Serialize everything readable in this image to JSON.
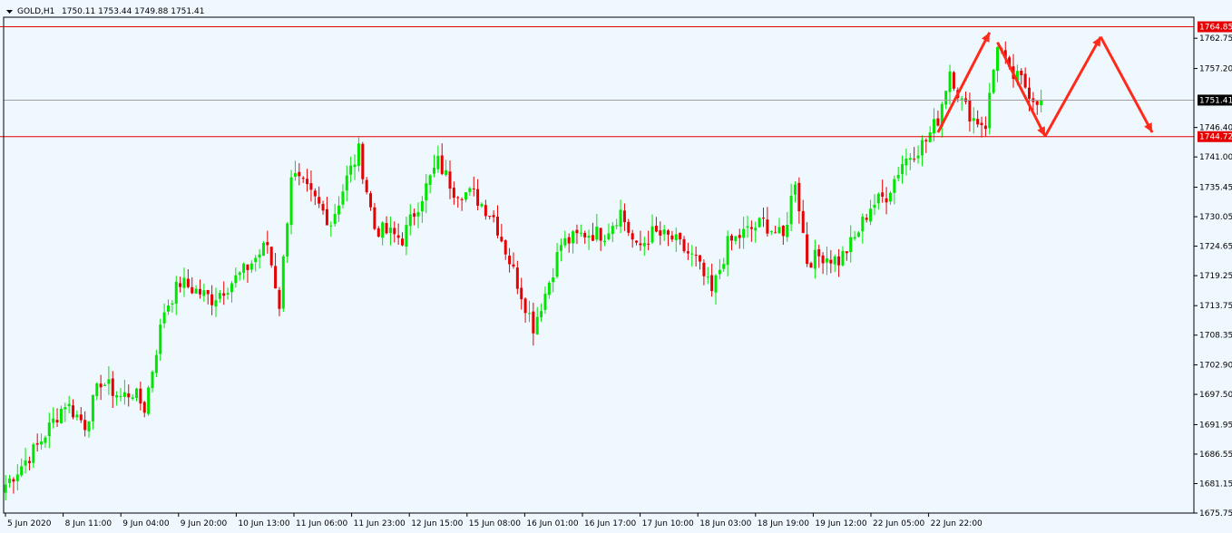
{
  "header": {
    "symbol": "GOLD,H1",
    "ohlc": "1750.11 1753.44 1749.88 1751.41"
  },
  "colors": {
    "background": "#f0f8ff",
    "bull": "#00e600",
    "bear": "#e60000",
    "level_line": "#e60000",
    "price_line": "#a0a0a0",
    "arrow": "#ff2a1a",
    "current_tag_bg": "#000000",
    "level_tag_bg": "#e60000"
  },
  "chart_data": {
    "type": "candlestick",
    "title": "GOLD,H1",
    "ylim": [
      1675.75,
      1766.6
    ],
    "y_ticks": [
      "1762.75",
      "1757.20",
      "1746.40",
      "1741.00",
      "1735.45",
      "1730.05",
      "1724.65",
      "1719.25",
      "1713.75",
      "1708.35",
      "1702.90",
      "1697.50",
      "1691.95",
      "1686.55",
      "1681.15",
      "1675.75"
    ],
    "x_ticks": [
      "5 Jun 2020",
      "8 Jun 11:00",
      "9 Jun 04:00",
      "9 Jun 20:00",
      "10 Jun 13:00",
      "11 Jun 06:00",
      "11 Jun 23:00",
      "12 Jun 15:00",
      "15 Jun 08:00",
      "16 Jun 01:00",
      "16 Jun 17:00",
      "17 Jun 10:00",
      "18 Jun 03:00",
      "18 Jun 19:00",
      "19 Jun 12:00",
      "22 Jun 05:00",
      "22 Jun 22:00"
    ],
    "current_price": "1751.41",
    "levels": [
      "1764.85",
      "1744.72"
    ],
    "anchors": [
      {
        "i": 0,
        "c": 1681
      },
      {
        "i": 8,
        "c": 1688
      },
      {
        "i": 15,
        "c": 1696
      },
      {
        "i": 20,
        "c": 1692
      },
      {
        "i": 24,
        "c": 1700
      },
      {
        "i": 29,
        "c": 1697
      },
      {
        "i": 32,
        "c": 1698
      },
      {
        "i": 35,
        "c": 1695
      },
      {
        "i": 40,
        "c": 1713
      },
      {
        "i": 44,
        "c": 1718
      },
      {
        "i": 52,
        "c": 1715
      },
      {
        "i": 60,
        "c": 1720
      },
      {
        "i": 66,
        "c": 1725
      },
      {
        "i": 69,
        "c": 1714
      },
      {
        "i": 72,
        "c": 1738
      },
      {
        "i": 78,
        "c": 1733
      },
      {
        "i": 82,
        "c": 1729
      },
      {
        "i": 86,
        "c": 1737
      },
      {
        "i": 89,
        "c": 1742
      },
      {
        "i": 93,
        "c": 1728
      },
      {
        "i": 100,
        "c": 1726
      },
      {
        "i": 105,
        "c": 1734
      },
      {
        "i": 109,
        "c": 1740
      },
      {
        "i": 113,
        "c": 1735
      },
      {
        "i": 118,
        "c": 1734
      },
      {
        "i": 123,
        "c": 1730
      },
      {
        "i": 128,
        "c": 1720
      },
      {
        "i": 133,
        "c": 1710
      },
      {
        "i": 136,
        "c": 1716
      },
      {
        "i": 140,
        "c": 1725
      },
      {
        "i": 146,
        "c": 1727
      },
      {
        "i": 151,
        "c": 1727
      },
      {
        "i": 155,
        "c": 1731
      },
      {
        "i": 159,
        "c": 1724
      },
      {
        "i": 163,
        "c": 1727
      },
      {
        "i": 168,
        "c": 1726
      },
      {
        "i": 174,
        "c": 1722
      },
      {
        "i": 178,
        "c": 1716
      },
      {
        "i": 182,
        "c": 1725
      },
      {
        "i": 186,
        "c": 1727
      },
      {
        "i": 191,
        "c": 1729
      },
      {
        "i": 196,
        "c": 1726
      },
      {
        "i": 199,
        "c": 1737
      },
      {
        "i": 202,
        "c": 1722
      },
      {
        "i": 206,
        "c": 1723
      },
      {
        "i": 210,
        "c": 1722
      },
      {
        "i": 214,
        "c": 1726
      },
      {
        "i": 218,
        "c": 1732
      },
      {
        "i": 222,
        "c": 1734
      },
      {
        "i": 226,
        "c": 1740
      },
      {
        "i": 232,
        "c": 1744
      },
      {
        "i": 235,
        "c": 1748
      },
      {
        "i": 238,
        "c": 1757
      },
      {
        "i": 241,
        "c": 1751
      },
      {
        "i": 244,
        "c": 1748
      },
      {
        "i": 247,
        "c": 1747
      },
      {
        "i": 250,
        "c": 1762
      },
      {
        "i": 253,
        "c": 1756
      },
      {
        "i": 256,
        "c": 1755
      },
      {
        "i": 259,
        "c": 1752
      },
      {
        "i": 261,
        "c": 1751.41
      }
    ],
    "annotations": {
      "arrows": [
        {
          "from": [
            235,
            1745.5
          ],
          "to": [
            248,
            1763.8
          ]
        },
        {
          "from": [
            250,
            1762.0
          ],
          "to": [
            262,
            1744.8
          ]
        },
        {
          "from": [
            262,
            1744.8
          ],
          "to": [
            276,
            1763.0
          ]
        },
        {
          "from": [
            276,
            1763.0
          ],
          "to": [
            289,
            1745.5
          ]
        }
      ]
    }
  }
}
